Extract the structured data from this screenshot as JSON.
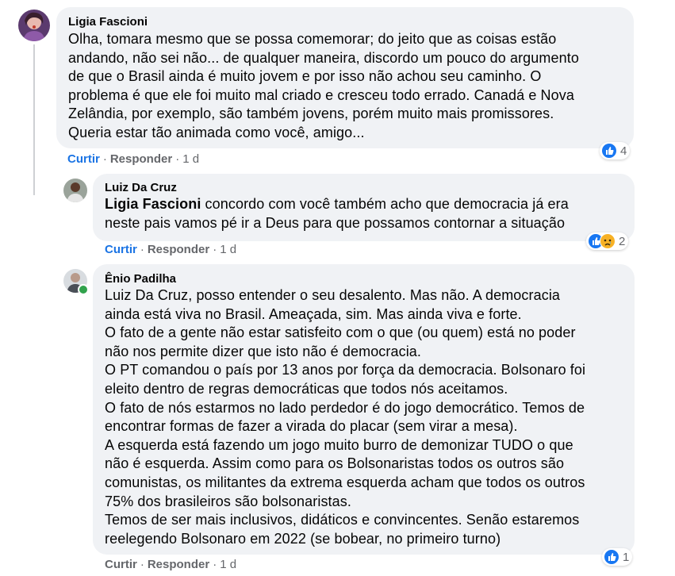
{
  "comments": [
    {
      "author": "Ligia Fascioni",
      "text": "Olha, tomara mesmo que se possa comemorar; do jeito que as coisas estão\nandando, não sei não... de qualquer maneira, discordo um pouco do argumento\nde que o Brasil ainda é muito jovem e por isso não achou seu caminho. O\nproblema é que ele foi muito mal criado e cresceu todo errado. Canadá e Nova\nZelândia, por exemplo, são também jovens, porém muito mais promissores.\nQueria estar tão animada como você, amigo...",
      "like_label": "Curtir",
      "reply_label": "Responder",
      "time": "1 d",
      "reaction_count": "4"
    },
    {
      "author": "Luiz Da Cruz",
      "mention": "Ligia Fascioni",
      "text_line1": " concordo com você também acho que democracia já era",
      "text_line2": "neste pais vamos pé ir a Deus para que possamos contornar a situação",
      "like_label": "Curtir",
      "reply_label": "Responder",
      "time": "1 d",
      "reaction_count": "2"
    },
    {
      "author": "Ênio Padilha",
      "text": "Luiz Da Cruz, posso entender o seu desalento. Mas não. A democracia\nainda está viva no Brasil. Ameaçada, sim. Mas ainda viva e forte.\nO fato de a gente não estar satisfeito com o que (ou quem) está no poder\nnão nos permite dizer que isto não é democracia.\nO PT comandou o país por 13 anos por força da democracia. Bolsonaro foi\neleito dentro de regras democráticas que todos nós aceitamos.\nO fato de nós estarmos no lado perdedor é do jogo democrático. Temos de\nencontrar formas de fazer a virada do placar (sem virar a mesa).\nA esquerda está fazendo um jogo muito burro de demonizar TUDO o que\nnão é esquerda. Assim como para os Bolsonaristas todos os outros são\ncomunistas, os militantes da extrema esquerda acham que todos os outros\n75% dos brasileiros são bolsonaristas.\nTemos de ser mais inclusivos, didáticos e convincentes. Senão estaremos\nreelegendo Bolsonaro em 2022 (se bobear, no primeiro turno)",
      "like_label": "Curtir",
      "reply_label": "Responder",
      "time": "1 d",
      "reaction_count": "1"
    }
  ],
  "separator": "·",
  "colors": {
    "bubble": "#f0f2f5",
    "like_blue": "#1b74e4",
    "muted": "#65676b",
    "online": "#31a24c"
  }
}
